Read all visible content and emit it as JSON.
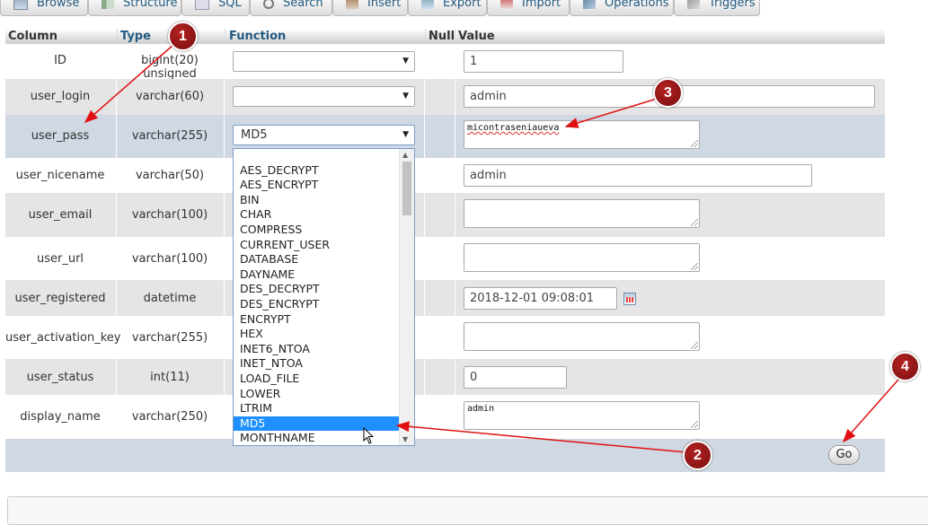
{
  "tabs": [
    {
      "label": "Browse",
      "icon": "browse-icon"
    },
    {
      "label": "Structure",
      "icon": "structure-icon"
    },
    {
      "label": "SQL",
      "icon": "sql-icon"
    },
    {
      "label": "Search",
      "icon": "search-icon"
    },
    {
      "label": "Insert",
      "icon": "insert-icon"
    },
    {
      "label": "Export",
      "icon": "export-icon"
    },
    {
      "label": "Import",
      "icon": "import-icon"
    },
    {
      "label": "Operations",
      "icon": "operations-icon"
    },
    {
      "label": "Triggers",
      "icon": "triggers-icon"
    }
  ],
  "headers": {
    "column": "Column",
    "type": "Type",
    "function": "Function",
    "null": "Null",
    "value": "Value"
  },
  "rows": [
    {
      "name": "ID",
      "type": "bigint(20) unsigned",
      "function": "",
      "value": "1"
    },
    {
      "name": "user_login",
      "type": "varchar(60)",
      "function": "",
      "value": "admin"
    },
    {
      "name": "user_pass",
      "type": "varchar(255)",
      "function": "MD5",
      "value": "micontraseniaueva"
    },
    {
      "name": "user_nicename",
      "type": "varchar(50)",
      "value": "admin"
    },
    {
      "name": "user_email",
      "type": "varchar(100)",
      "value": ""
    },
    {
      "name": "user_url",
      "type": "varchar(100)",
      "value": ""
    },
    {
      "name": "user_registered",
      "type": "datetime",
      "value": "2018-12-01 09:08:01"
    },
    {
      "name": "user_activation_key",
      "type": "varchar(255)",
      "value": ""
    },
    {
      "name": "user_status",
      "type": "int(11)",
      "value": "0"
    },
    {
      "name": "display_name",
      "type": "varchar(250)",
      "value": "admin"
    }
  ],
  "dropdown": {
    "options": [
      "AES_DECRYPT",
      "AES_ENCRYPT",
      "BIN",
      "CHAR",
      "COMPRESS",
      "CURRENT_USER",
      "DATABASE",
      "DAYNAME",
      "DES_DECRYPT",
      "DES_ENCRYPT",
      "ENCRYPT",
      "HEX",
      "INET6_NTOA",
      "INET_NTOA",
      "LOAD_FILE",
      "LOWER",
      "LTRIM",
      "MD5",
      "MONTHNAME"
    ],
    "selected": "MD5"
  },
  "go_button": "Go",
  "markers": [
    "1",
    "2",
    "3",
    "4"
  ],
  "colors": {
    "link": "#235a81",
    "highlight_row": "#cfd8e3",
    "selected_option": "#1e90ff",
    "marker": "#9a1a1a",
    "arrow": "#e01010"
  }
}
